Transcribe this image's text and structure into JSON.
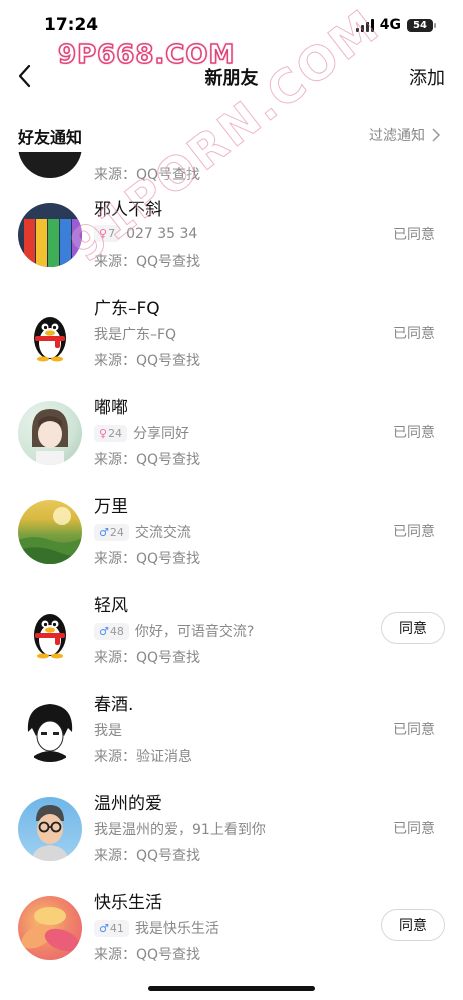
{
  "status_bar": {
    "time": "17:24",
    "network": "4G",
    "battery": "54"
  },
  "watermarks": {
    "top": "9P668.COM",
    "diagonal": "91PORN.COM"
  },
  "nav": {
    "title": "新朋友",
    "add_label": "添加"
  },
  "section": {
    "title": "好友通知",
    "filter_label": "过滤通知"
  },
  "partial_row": {
    "source": "来源：QQ号查找"
  },
  "requests": [
    {
      "name": "邪人不斜",
      "gender": "female",
      "gender_symbol": "♀",
      "age": "7",
      "message": "027 35 34",
      "source": "来源：QQ号查找",
      "status": "已同意",
      "avatar_icon": "pencils-avatar"
    },
    {
      "name": "广东–FQ",
      "gender": "",
      "gender_symbol": "",
      "age": "",
      "message": "我是广东–FQ",
      "source": "来源：QQ号查找",
      "status": "已同意",
      "avatar_icon": "qq-penguin-avatar"
    },
    {
      "name": "嘟嘟",
      "gender": "female",
      "gender_symbol": "♀",
      "age": "24",
      "message": "分享同好",
      "source": "来源：QQ号查找",
      "status": "已同意",
      "avatar_icon": "anime-portrait-avatar"
    },
    {
      "name": "万里",
      "gender": "male",
      "gender_symbol": "♂",
      "age": "24",
      "message": "交流交流",
      "source": "来源：QQ号查找",
      "status": "已同意",
      "avatar_icon": "field-avatar"
    },
    {
      "name": "轻风",
      "gender": "male",
      "gender_symbol": "♂",
      "age": "48",
      "message": "你好，可语音交流?",
      "source": "来源：QQ号查找",
      "status": "",
      "button": "同意",
      "avatar_icon": "qq-penguin-avatar"
    },
    {
      "name": "春酒.",
      "gender": "",
      "gender_symbol": "",
      "age": "",
      "message": "我是",
      "source": "来源：验证消息",
      "status": "已同意",
      "avatar_icon": "anime-boy-avatar"
    },
    {
      "name": "温州的爱",
      "gender": "",
      "gender_symbol": "",
      "age": "",
      "message": "我是温州的爱，91上看到你",
      "source": "来源：QQ号查找",
      "status": "已同意",
      "avatar_icon": "cartoon-man-avatar"
    },
    {
      "name": "快乐生活",
      "gender": "male",
      "gender_symbol": "♂",
      "age": "41",
      "message": "我是快乐生活",
      "source": "来源：QQ号查找",
      "status": "",
      "button": "同意",
      "avatar_icon": "flower-avatar"
    }
  ],
  "colors": {
    "accent_female": "#ef6fa8",
    "accent_male": "#4a8ef0",
    "muted_text": "#888888",
    "watermark": "#e0447a"
  }
}
